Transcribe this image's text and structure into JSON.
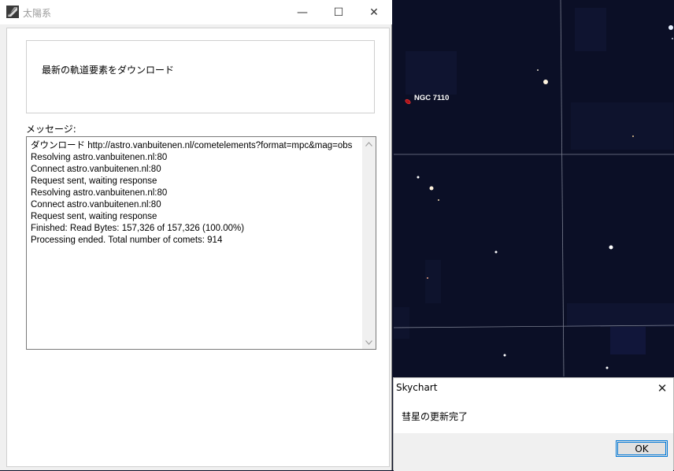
{
  "sky": {
    "object_label": "NGC 7110",
    "grid_color": "#7a7f90",
    "background": "#0b0f26"
  },
  "solar_window": {
    "title": "太陽系",
    "icon": "skychart-app-icon",
    "controls": {
      "minimize": "—",
      "maximize": "☐",
      "close": "✕"
    },
    "action_text": "最新の軌道要素をダウンロード",
    "messages_label": "メッセージ:",
    "log": [
      "ダウンロード http://astro.vanbuitenen.nl/cometelements?format=mpc&mag=obs",
      "Resolving astro.vanbuitenen.nl:80",
      "Connect astro.vanbuitenen.nl:80",
      "Request sent, waiting response",
      "Resolving astro.vanbuitenen.nl:80",
      "Connect astro.vanbuitenen.nl:80",
      "Request sent, waiting response",
      "Finished: Read Bytes: 157,326 of 157,326 (100.00%)",
      "Processing ended. Total number of comets: 914"
    ]
  },
  "dialog": {
    "title": "Skychart",
    "message": "彗星の更新完了",
    "ok_label": "OK",
    "close": "✕"
  }
}
